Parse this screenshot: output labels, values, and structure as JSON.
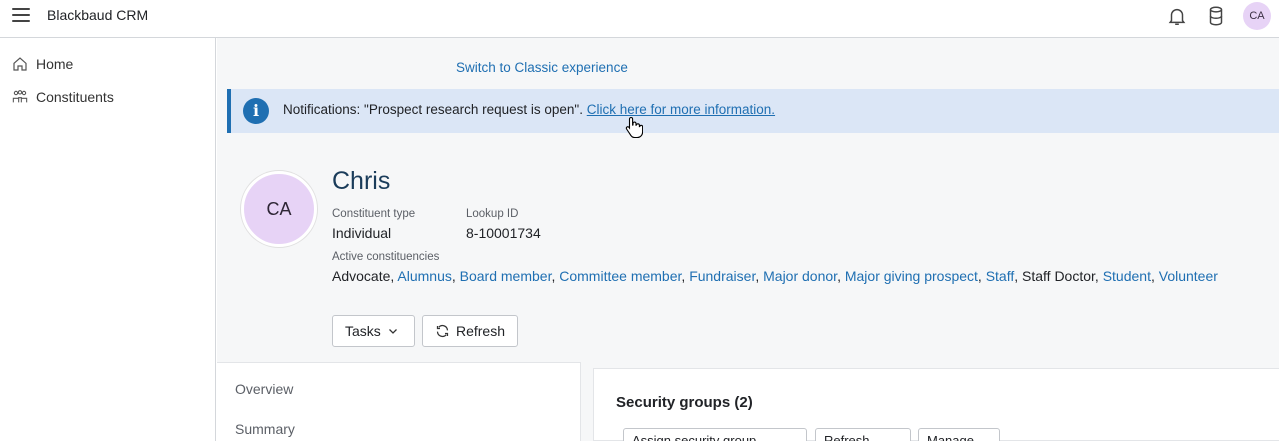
{
  "app": {
    "title": "Blackbaud CRM",
    "user_initials": "CA"
  },
  "sidebar": {
    "items": [
      {
        "label": "Home",
        "icon": "home-icon"
      },
      {
        "label": "Constituents",
        "icon": "people-icon"
      }
    ]
  },
  "main": {
    "switch_link": "Switch to Classic experience",
    "notification": {
      "text": "Notifications: \"Prospect research request is open\". ",
      "link": "Click here for more information."
    },
    "profile": {
      "initials": "CA",
      "name": "Chris",
      "constituent_type_label": "Constituent type",
      "constituent_type": "Individual",
      "lookup_id_label": "Lookup ID",
      "lookup_id": "8-10001734",
      "active_label": "Active constituencies",
      "constituencies": [
        {
          "text": "Advocate",
          "link": false
        },
        {
          "text": "Alumnus",
          "link": true
        },
        {
          "text": "Board member",
          "link": true
        },
        {
          "text": "Committee member",
          "link": true
        },
        {
          "text": "Fundraiser",
          "link": true
        },
        {
          "text": "Major donor",
          "link": true
        },
        {
          "text": "Major giving prospect",
          "link": true
        },
        {
          "text": "Staff",
          "link": true
        },
        {
          "text": "Staff Doctor",
          "link": false
        },
        {
          "text": "Student",
          "link": true
        },
        {
          "text": "Volunteer",
          "link": true
        }
      ]
    },
    "buttons": {
      "tasks": "Tasks",
      "refresh": "Refresh"
    },
    "tabs": [
      {
        "label": "Overview"
      },
      {
        "label": "Summary"
      }
    ],
    "security_panel": {
      "title": "Security groups (2)",
      "buttons": [
        "Assign security group",
        "Refresh",
        "Manage"
      ]
    }
  },
  "colors": {
    "link": "#1f6fb2",
    "avatar_bg": "#e7d3f6",
    "notification_bg": "#dbe6f6"
  }
}
